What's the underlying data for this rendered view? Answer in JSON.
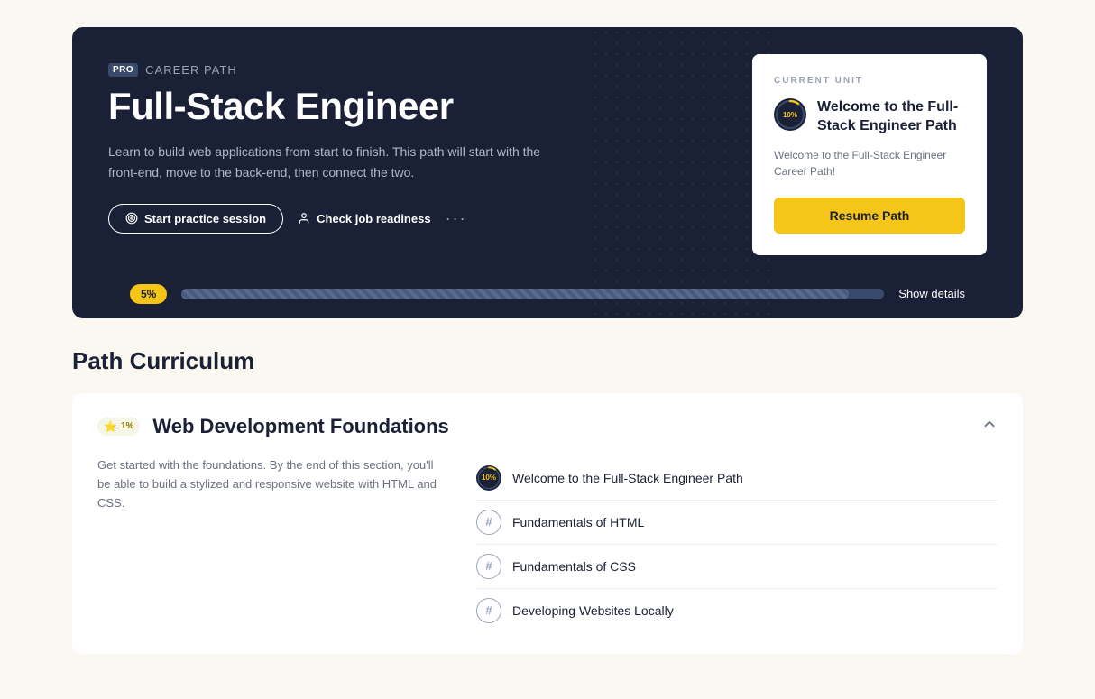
{
  "page": {
    "background": "#faf8f0"
  },
  "hero": {
    "pro_badge": "PRO",
    "career_path_label": "Career Path",
    "title": "Full-Stack Engineer",
    "description": "Learn to build web applications from start to finish. This path will start with the front-end, move to the back-end, then connect the two.",
    "btn_practice": "Start practice session",
    "btn_job_readiness": "Check job readiness",
    "more_icon": "···"
  },
  "current_unit": {
    "label": "CURRENT UNIT",
    "progress_pct": "10%",
    "title": "Welcome to the Full-Stack Engineer Path",
    "description": "Welcome to the Full-Stack Engineer Career Path!",
    "resume_btn": "Resume Path"
  },
  "progress_bar": {
    "pct_label": "5%",
    "fill_width": "5%",
    "show_details": "Show details"
  },
  "curriculum": {
    "section_title": "Path Curriculum",
    "unit_badge_pct": "1%",
    "unit_title": "Web Development Foundations",
    "unit_description": "Get started with the foundations. By the end of this section, you'll be able to build a stylized and responsive website with HTML and CSS.",
    "lessons": [
      {
        "icon_type": "progress",
        "icon_pct": "10%",
        "name": "Welcome to the Full-Stack Engineer Path"
      },
      {
        "icon_type": "default",
        "icon_char": "#",
        "name": "Fundamentals of HTML"
      },
      {
        "icon_type": "default",
        "icon_char": "#",
        "name": "Fundamentals of CSS"
      },
      {
        "icon_type": "default",
        "icon_char": "#",
        "name": "Developing Websites Locally"
      }
    ]
  }
}
